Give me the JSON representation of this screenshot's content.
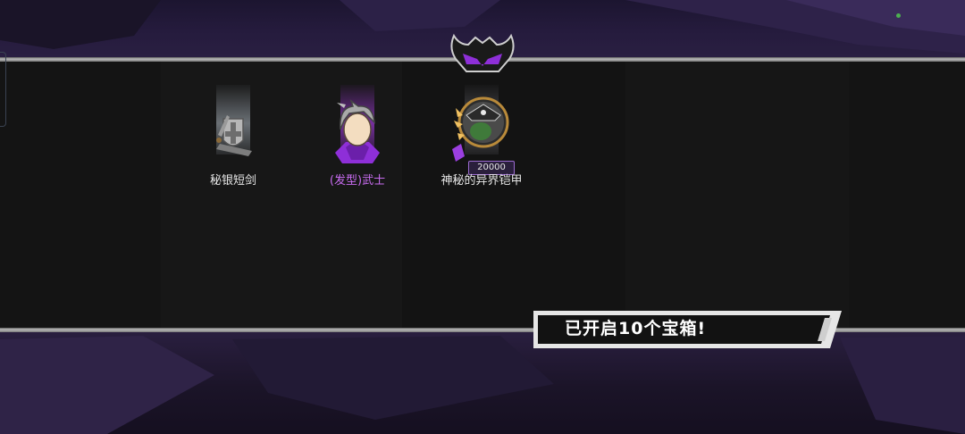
{
  "rewards": [
    {
      "name": "秘银短剑",
      "icon": "sword-shield-icon",
      "rarity": "common"
    },
    {
      "name": "(发型)武士",
      "icon": "samurai-hair-icon",
      "rarity": "epic"
    },
    {
      "name": "神秘的异界铠甲",
      "icon": "orc-pirate-armor-icon",
      "rarity": "legendary",
      "price": "20000"
    }
  ],
  "banner": {
    "text": "已开启10个宝箱!"
  },
  "colors": {
    "accent_purple": "#9b3fe0",
    "name_purple": "#c86cf0",
    "panel": "#141414"
  }
}
